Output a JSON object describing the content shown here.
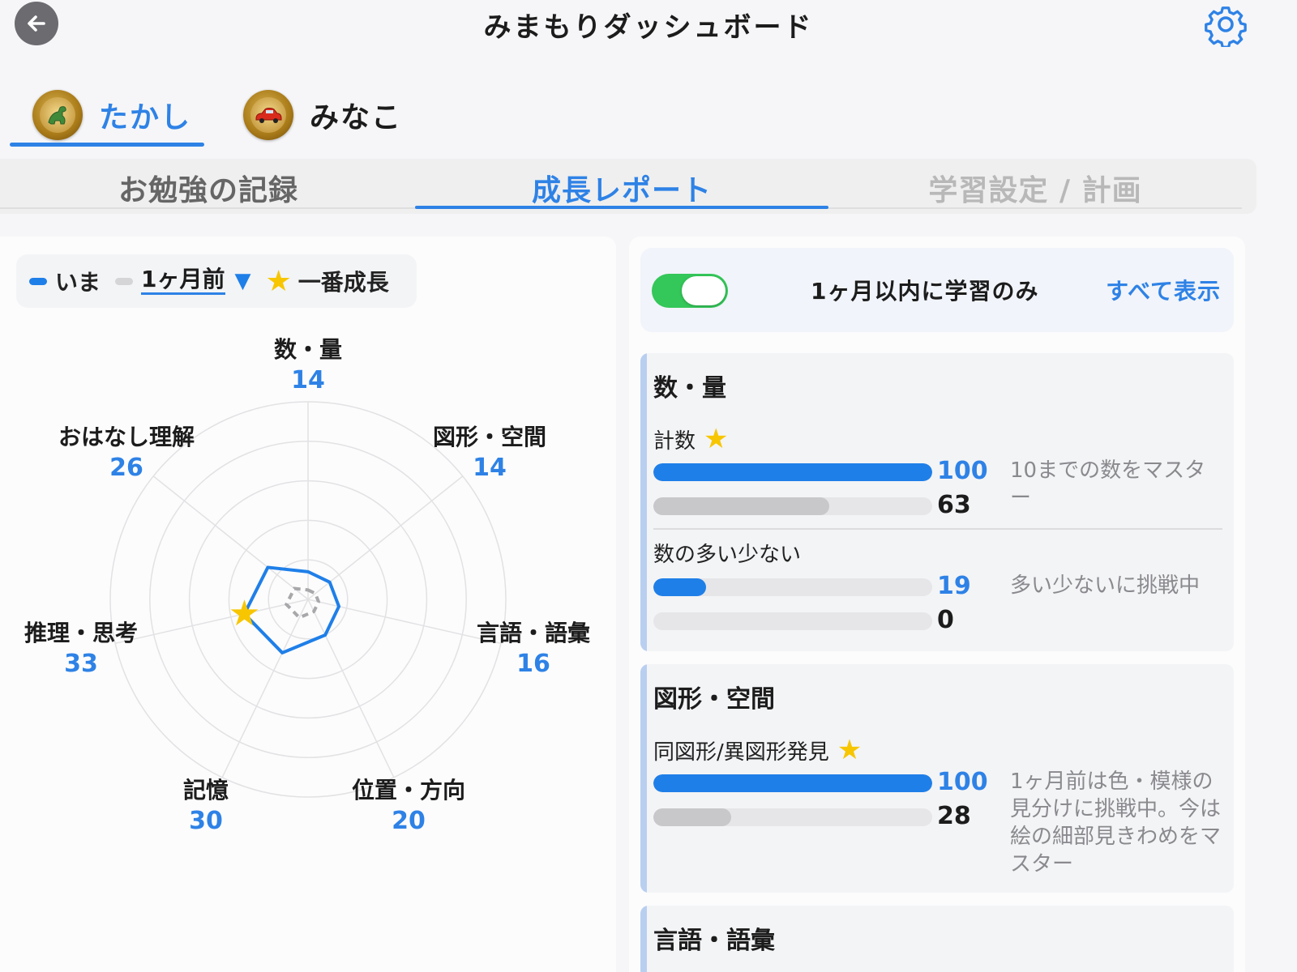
{
  "header": {
    "title": "みまもりダッシュボード",
    "back_icon": "arrow-left-icon",
    "settings_icon": "gear-icon"
  },
  "children": [
    {
      "name": "たかし",
      "active": true,
      "avatar": "dinosaur-avatar"
    },
    {
      "name": "みなこ",
      "active": false,
      "avatar": "red-car-avatar"
    }
  ],
  "tabs": [
    {
      "label": "お勉強の記録",
      "state": "normal"
    },
    {
      "label": "成長レポート",
      "state": "active"
    },
    {
      "label": "学習設定 / 計画",
      "state": "dim"
    }
  ],
  "legend": {
    "now_label": "いま",
    "prev_label": "1ヶ月前",
    "dropdown_icon": "triangle-down-icon",
    "star_label": "一番成長"
  },
  "radar": {
    "axes": [
      {
        "label": "数・量",
        "value": "14"
      },
      {
        "label": "図形・空間",
        "value": "14"
      },
      {
        "label": "言語・語彙",
        "value": "16"
      },
      {
        "label": "位置・方向",
        "value": "20"
      },
      {
        "label": "記憶",
        "value": "30"
      },
      {
        "label": "推理・思考",
        "value": "33"
      },
      {
        "label": "おはなし理解",
        "value": "26"
      }
    ],
    "max": 100,
    "best_growth_axis": "推理・思考",
    "colors": {
      "now": "#1f7fe8",
      "prev": "#a8a8aa",
      "star": "#f7c600",
      "grid": "#e2e2e4"
    }
  },
  "filter": {
    "toggle_on": true,
    "label": "1ヶ月以内に学習のみ",
    "show_all": "すべて表示"
  },
  "categories": [
    {
      "title": "数・量",
      "skills": [
        {
          "name": "計数",
          "star": true,
          "now": "100",
          "prev": "63",
          "desc": "10までの数をマスター"
        },
        {
          "name": "数の多い少ない",
          "star": false,
          "now": "19",
          "prev": "0",
          "desc": "多い少ないに挑戦中"
        }
      ]
    },
    {
      "title": "図形・空間",
      "skills": [
        {
          "name": "同図形/異図形発見",
          "star": true,
          "now": "100",
          "prev": "28",
          "desc": "1ヶ月前は色・模様の見分けに挑戦中。今は絵の細部見きわめをマスター"
        }
      ]
    },
    {
      "title": "言語・語彙",
      "skills": []
    }
  ]
}
